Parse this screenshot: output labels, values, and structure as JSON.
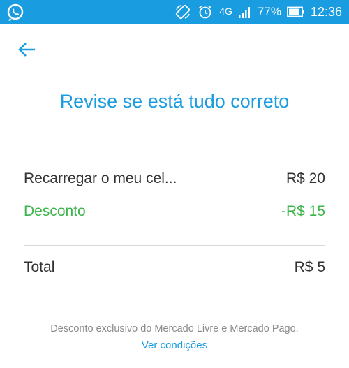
{
  "status_bar": {
    "app_icon": "whatsapp-icon",
    "icons": [
      "screen-rotation-icon",
      "alarm-icon",
      "signal-icon",
      "battery-icon"
    ],
    "network": "4G",
    "battery": "77%",
    "time": "12:36",
    "color": "#1a9ce0"
  },
  "header": {
    "back_icon": "arrow-left-icon"
  },
  "title": "Revise se está tudo correto",
  "summary": {
    "item_label": "Recarregar o meu cel...",
    "item_value": "R$ 20",
    "discount_label": "Desconto",
    "discount_value": "-R$ 15",
    "total_label": "Total",
    "total_value": "R$ 5"
  },
  "footer": {
    "note": "Desconto exclusivo do Mercado Livre e Mercado Pago.",
    "link": "Ver condições"
  },
  "colors": {
    "accent": "#1a9ce0",
    "discount": "#3bb54a",
    "text": "#333333",
    "muted": "#8a8a8a"
  }
}
